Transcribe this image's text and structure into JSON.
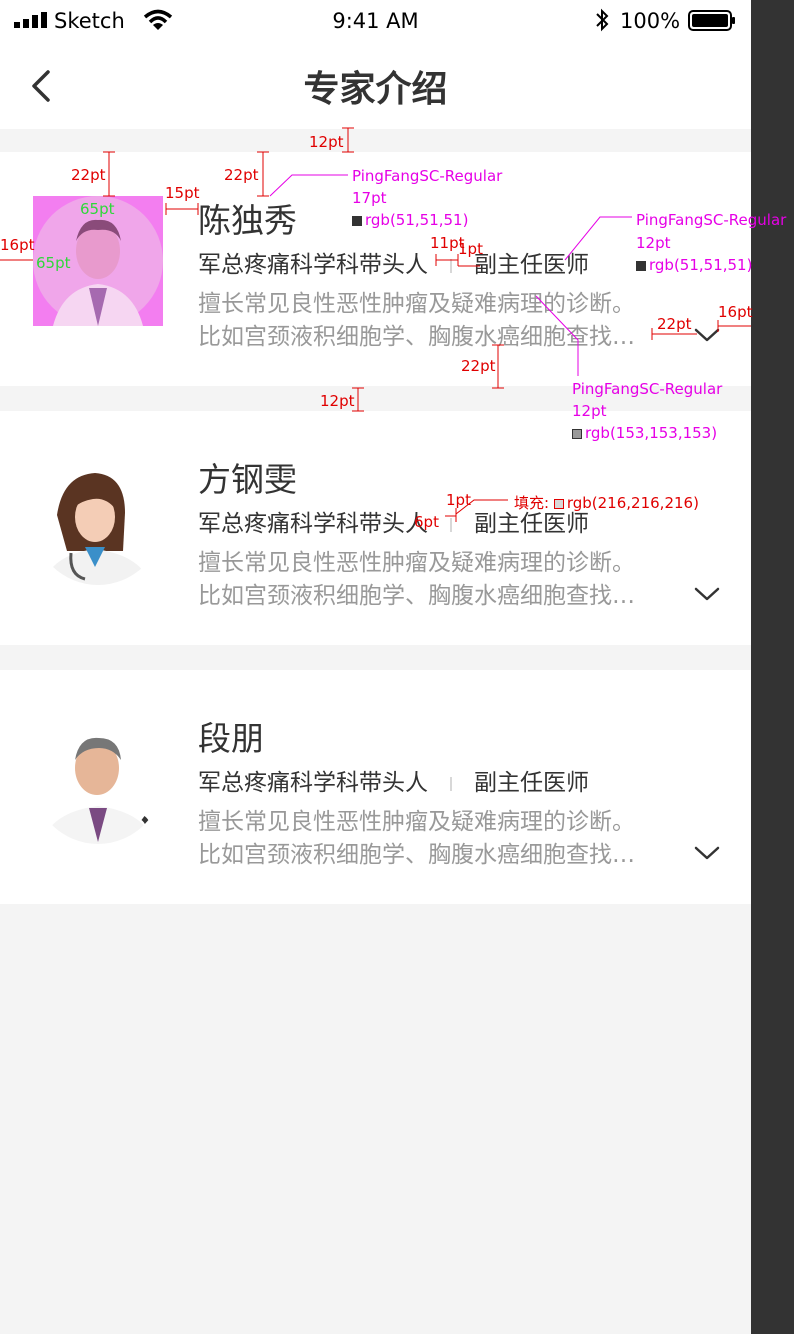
{
  "status_bar": {
    "carrier": "Sketch",
    "time": "9:41 AM",
    "battery": "100%"
  },
  "nav": {
    "back_icon": "chevron-left-icon",
    "title": "专家介绍"
  },
  "experts": [
    {
      "name": "陈独秀",
      "department": "军总疼痛科学科带头人",
      "title": "副主任医师",
      "desc_line1": "擅长常见良性恶性肿瘤及疑难病理的诊断。",
      "desc_line2": "比如宫颈液积细胞学、胸腹水癌细胞查找…"
    },
    {
      "name": "方钢雯",
      "department": "军总疼痛科学科带头人",
      "title": "副主任医师",
      "desc_line1": "擅长常见良性恶性肿瘤及疑难病理的诊断。",
      "desc_line2": "比如宫颈液积细胞学、胸腹水癌细胞查找…"
    },
    {
      "name": "段朋",
      "department": "军总疼痛科学科带头人",
      "title": "副主任医师",
      "desc_line1": "擅长常见良性恶性肿瘤及疑难病理的诊断。",
      "desc_line2": "比如宫颈液积细胞学、胸腹水癌细胞查找…"
    }
  ],
  "annotations": {
    "gap_12pt": "12pt",
    "avatar_top": "22pt",
    "name_top": "22pt",
    "avatar_gap": "15pt",
    "avatar_w": "65pt",
    "avatar_h": "65pt",
    "left_margin": "16pt",
    "name_font": "PingFangSC-Regular",
    "name_size": "17pt",
    "name_color": "rgb(51,51,51)",
    "dept_font": "PingFangSC-Regular",
    "dept_size": "12pt",
    "dept_color": "rgb(51,51,51)",
    "sep_gap": "11pt",
    "sep_w": "1pt",
    "arrow_gap": "22pt",
    "right_margin": "16pt",
    "bottom_gap": "22pt",
    "gap2_12pt": "12pt",
    "desc_font": "PingFangSC-Regular",
    "desc_size": "12pt",
    "desc_color": "rgb(153,153,153)",
    "sep2_w": "1pt",
    "sep2_h": "6pt",
    "fill_label": "填充:",
    "fill_color": "rgb(216,216,216)"
  },
  "colors": {
    "primary_text": "#333333",
    "secondary_text": "#999999",
    "separator": "#d8d8d8",
    "background": "#f4f4f4",
    "annotation_red": "#e00000",
    "annotation_magenta": "#e600e6"
  }
}
